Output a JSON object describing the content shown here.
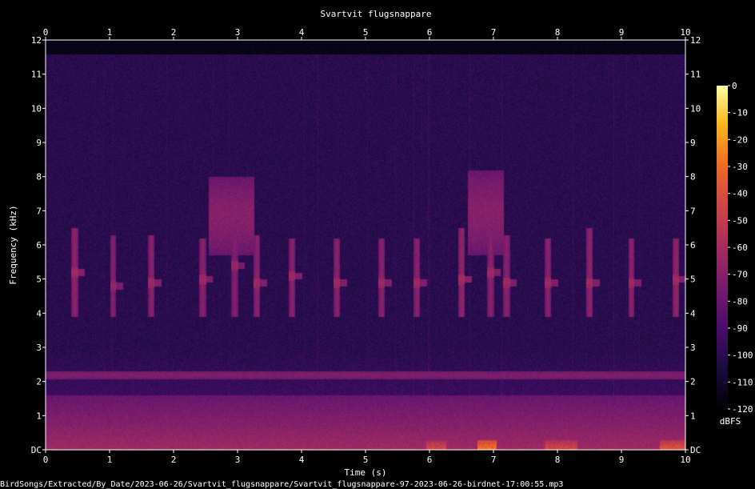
{
  "chart_data": {
    "type": "heatmap",
    "title": "Svartvit flugsnappare",
    "xlabel": "Time (s)",
    "ylabel": "Frequency (kHz)",
    "xlim": [
      0,
      10
    ],
    "ylim": [
      0,
      12
    ],
    "x_ticks": [
      0,
      1,
      2,
      3,
      4,
      5,
      6,
      7,
      8,
      9,
      10
    ],
    "y_ticks": [
      "DC",
      "1",
      "2",
      "3",
      "4",
      "5",
      "6",
      "7",
      "8",
      "9",
      "10",
      "11",
      "12"
    ],
    "y_tick_values": [
      0,
      1,
      2,
      3,
      4,
      5,
      6,
      7,
      8,
      9,
      10,
      11,
      12
    ],
    "colorbar": {
      "label": "dBFS",
      "range": [
        -120,
        0
      ],
      "ticks": [
        "0",
        "-10",
        "-20",
        "-30",
        "-40",
        "-50",
        "-60",
        "-70",
        "-80",
        "-90",
        "-100",
        "-110",
        "-120"
      ],
      "tick_values": [
        0,
        -10,
        -20,
        -30,
        -40,
        -50,
        -60,
        -70,
        -80,
        -90,
        -100,
        -110,
        -120
      ],
      "colormap": "magma"
    },
    "background_level_dbfs": -100,
    "noise_band_top_khz": 11.6,
    "low_frequency_band": {
      "freq_max_khz": 1.6,
      "level_dbfs": -70
    },
    "hum_band": {
      "freq_khz": 2.2,
      "level_dbfs": -72
    },
    "calls": [
      {
        "t": 0.45,
        "f_low_khz": 3.9,
        "f_high_khz": 6.5,
        "peak_khz": 5.2,
        "level_dbfs": -65
      },
      {
        "t": 1.05,
        "f_low_khz": 3.9,
        "f_high_khz": 6.3,
        "peak_khz": 4.8,
        "level_dbfs": -68
      },
      {
        "t": 1.65,
        "f_low_khz": 3.9,
        "f_high_khz": 6.3,
        "peak_khz": 4.9,
        "level_dbfs": -66
      },
      {
        "t": 2.45,
        "f_low_khz": 3.9,
        "f_high_khz": 6.2,
        "peak_khz": 5.0,
        "level_dbfs": -66
      },
      {
        "t": 2.95,
        "f_low_khz": 3.9,
        "f_high_khz": 6.2,
        "peak_khz": 5.4,
        "level_dbfs": -68
      },
      {
        "t": 3.3,
        "f_low_khz": 3.9,
        "f_high_khz": 6.3,
        "peak_khz": 4.9,
        "level_dbfs": -66
      },
      {
        "t": 3.85,
        "f_low_khz": 3.9,
        "f_high_khz": 6.2,
        "peak_khz": 5.1,
        "level_dbfs": -66
      },
      {
        "t": 4.55,
        "f_low_khz": 3.9,
        "f_high_khz": 6.2,
        "peak_khz": 4.9,
        "level_dbfs": -66
      },
      {
        "t": 5.25,
        "f_low_khz": 3.9,
        "f_high_khz": 6.2,
        "peak_khz": 4.9,
        "level_dbfs": -66
      },
      {
        "t": 5.8,
        "f_low_khz": 3.9,
        "f_high_khz": 6.2,
        "peak_khz": 4.9,
        "level_dbfs": -66
      },
      {
        "t": 6.5,
        "f_low_khz": 3.9,
        "f_high_khz": 6.5,
        "peak_khz": 5.0,
        "level_dbfs": -64
      },
      {
        "t": 6.95,
        "f_low_khz": 3.9,
        "f_high_khz": 6.3,
        "peak_khz": 5.2,
        "level_dbfs": -66
      },
      {
        "t": 7.2,
        "f_low_khz": 3.9,
        "f_high_khz": 6.3,
        "peak_khz": 4.9,
        "level_dbfs": -66
      },
      {
        "t": 7.85,
        "f_low_khz": 3.9,
        "f_high_khz": 6.2,
        "peak_khz": 4.9,
        "level_dbfs": -66
      },
      {
        "t": 8.5,
        "f_low_khz": 3.9,
        "f_high_khz": 6.5,
        "peak_khz": 4.9,
        "level_dbfs": -65
      },
      {
        "t": 9.15,
        "f_low_khz": 3.9,
        "f_high_khz": 6.2,
        "peak_khz": 4.9,
        "level_dbfs": -66
      },
      {
        "t": 9.85,
        "f_low_khz": 3.9,
        "f_high_khz": 6.2,
        "peak_khz": 5.0,
        "level_dbfs": -64
      }
    ],
    "broadband_bursts": [
      {
        "t_start": 2.55,
        "t_end": 3.25,
        "f_low_khz": 5.7,
        "f_high_khz": 8.0,
        "level_dbfs": -70
      },
      {
        "t_start": 6.6,
        "t_end": 7.15,
        "f_low_khz": 5.7,
        "f_high_khz": 8.2,
        "level_dbfs": -70
      }
    ],
    "low_frequency_hotspots": [
      {
        "t_start": 5.95,
        "t_end": 6.25,
        "level_dbfs": -40
      },
      {
        "t_start": 6.75,
        "t_end": 7.05,
        "level_dbfs": -25
      },
      {
        "t_start": 7.8,
        "t_end": 8.3,
        "level_dbfs": -40
      },
      {
        "t_start": 9.6,
        "t_end": 10.0,
        "level_dbfs": -35
      }
    ]
  },
  "footer": {
    "file_path": "BirdSongs/Extracted/By_Date/2023-06-26/Svartvit_flugsnappare/Svartvit_flugsnappare-97-2023-06-26-birdnet-17:00:55.mp3"
  }
}
